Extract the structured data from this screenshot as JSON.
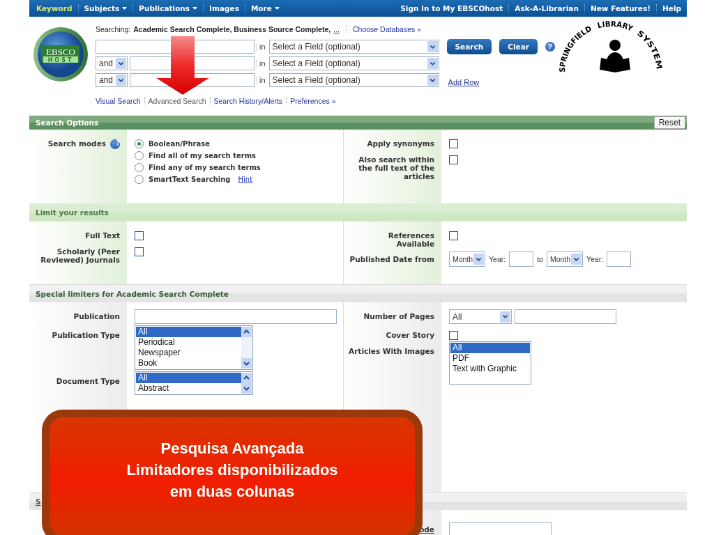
{
  "top_nav": {
    "left": [
      {
        "label": "Keyword",
        "selected": true,
        "dropdown": false
      },
      {
        "label": "Subjects",
        "selected": false,
        "dropdown": true
      },
      {
        "label": "Publications",
        "selected": false,
        "dropdown": true
      },
      {
        "label": "Images",
        "selected": false,
        "dropdown": false
      },
      {
        "label": "More",
        "selected": false,
        "dropdown": true
      }
    ],
    "right": [
      "Sign In to My EBSCOhost",
      "Ask-A-Librarian",
      "New Features!",
      "Help"
    ]
  },
  "logo": {
    "title": "EBSCO",
    "subtitle": "HOST"
  },
  "search": {
    "searching_label": "Searching:",
    "databases": "Academic Search Complete, Business Source Complete,",
    "more": "...",
    "choose_databases": "Choose Databases »",
    "rows": [
      {
        "in_label": "in",
        "field": "Select a Field (optional)"
      },
      {
        "operator": "and",
        "in_label": "in",
        "field": "Select a Field (optional)"
      },
      {
        "operator": "and",
        "in_label": "in",
        "field": "Select a Field (optional)"
      }
    ],
    "buttons": [
      "Search",
      "Clear"
    ],
    "help": "?",
    "add_row": "Add Row",
    "links": [
      {
        "label": "Visual Search",
        "selected": false
      },
      {
        "label": "Advanced Search",
        "selected": true
      },
      {
        "label": "Search History/Alerts",
        "selected": false
      },
      {
        "label": "Preferences »",
        "selected": false
      }
    ]
  },
  "library_logo": {
    "text_parts": [
      "SPRINGFIELD",
      "LIBRARY",
      "SYSTEM"
    ]
  },
  "sections": [
    {
      "kind": "options",
      "title": "Search Options",
      "reset": "Reset",
      "left": [
        {
          "kind": "radios",
          "label": "Search modes",
          "help": "?",
          "options": [
            {
              "label": "Boolean/Phrase",
              "selected": true
            },
            {
              "label": "Find all of my search terms",
              "selected": false
            },
            {
              "label": "Find any of my search terms",
              "selected": false
            },
            {
              "label": "SmartText Searching",
              "selected": false,
              "link": "Hint"
            }
          ]
        }
      ],
      "right": [
        {
          "kind": "checkbox",
          "label": "Apply synonyms",
          "checked": false
        },
        {
          "kind": "checkbox",
          "label": "Also search within the full text of the articles",
          "checked": false
        }
      ]
    },
    {
      "kind": "limits",
      "title": "Limit your results",
      "left": [
        {
          "kind": "checkbox",
          "label": "Full Text",
          "checked": false
        },
        {
          "kind": "checkbox",
          "label": "Scholarly (Peer Reviewed) Journals",
          "checked": false
        }
      ],
      "right": [
        {
          "kind": "checkbox",
          "label": "References Available",
          "checked": false
        },
        {
          "kind": "date",
          "label": "Published Date from",
          "month": "Month",
          "year_label": "Year:",
          "to": "to",
          "month_2": "Month",
          "year_label_2": "Year:"
        }
      ]
    },
    {
      "kind": "special",
      "title": "Special limiters for Academic Search Complete",
      "left": [
        {
          "kind": "text",
          "label": "Publication"
        },
        {
          "kind": "listbox",
          "label": "Publication Type",
          "scrollable": true,
          "items": [
            {
              "label": "All",
              "selected": true
            },
            {
              "label": "Periodical",
              "selected": false
            },
            {
              "label": "Newspaper",
              "selected": false
            },
            {
              "label": "Book",
              "selected": false
            }
          ]
        },
        {
          "kind": "listbox",
          "label": "Document Type",
          "scrollable": true,
          "items": [
            {
              "label": "All",
              "selected": true
            },
            {
              "label": "Abstract",
              "selected": false
            }
          ]
        }
      ],
      "right": [
        {
          "kind": "select_text",
          "label": "Number of Pages",
          "value": "All"
        },
        {
          "kind": "checkbox",
          "label": "Cover Story",
          "checked": false
        },
        {
          "kind": "listbox",
          "label": "Articles With Images",
          "scrollable": false,
          "items": [
            {
              "label": "All",
              "selected": true
            },
            {
              "label": "PDF",
              "selected": false
            },
            {
              "label": "Text with Graphic",
              "selected": false
            }
          ]
        }
      ]
    },
    {
      "kind": "more",
      "title": "S",
      "right": [
        {
          "kind": "text_short",
          "label": "ode"
        }
      ]
    }
  ],
  "callout": {
    "lines": [
      "Pesquisa Avançada",
      "Limitadores disponibilizados",
      "em duas colunas"
    ]
  }
}
